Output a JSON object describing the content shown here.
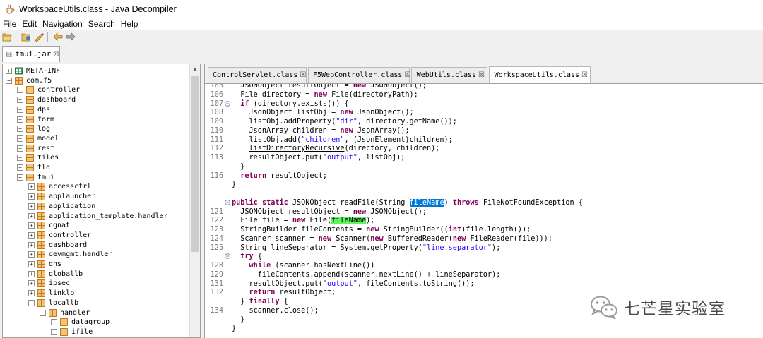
{
  "window": {
    "title": "WorkspaceUtils.class - Java Decompiler"
  },
  "menu": [
    "File",
    "Edit",
    "Navigation",
    "Search",
    "Help"
  ],
  "toolbar": {
    "buttons": [
      "open-file-icon",
      "open-type-icon",
      "open-type-hierarchy-icon",
      "back-icon",
      "forward-icon"
    ]
  },
  "file_tab": {
    "label": "tmui.jar",
    "close": "☒"
  },
  "tree": [
    {
      "label": "META-INF",
      "expander": "+",
      "icon": "folder"
    },
    {
      "label": "com.f5",
      "expander": "−",
      "icon": "package"
    },
    {
      "label": "controller",
      "expander": "+",
      "icon": "package"
    },
    {
      "label": "dashboard",
      "expander": "+",
      "icon": "package"
    },
    {
      "label": "dps",
      "expander": "+",
      "icon": "package"
    },
    {
      "label": "form",
      "expander": "+",
      "icon": "package"
    },
    {
      "label": "log",
      "expander": "+",
      "icon": "package"
    },
    {
      "label": "model",
      "expander": "+",
      "icon": "package"
    },
    {
      "label": "rest",
      "expander": "+",
      "icon": "package"
    },
    {
      "label": "tiles",
      "expander": "+",
      "icon": "package"
    },
    {
      "label": "tld",
      "expander": "+",
      "icon": "package"
    },
    {
      "label": "tmui",
      "expander": "−",
      "icon": "package"
    },
    {
      "label": "accessctrl",
      "expander": "+",
      "icon": "package"
    },
    {
      "label": "applauncher",
      "expander": "+",
      "icon": "package"
    },
    {
      "label": "application",
      "expander": "+",
      "icon": "package"
    },
    {
      "label": "application_template.handler",
      "expander": "+",
      "icon": "package"
    },
    {
      "label": "cgnat",
      "expander": "+",
      "icon": "package"
    },
    {
      "label": "controller",
      "expander": "+",
      "icon": "package"
    },
    {
      "label": "dashboard",
      "expander": "+",
      "icon": "package"
    },
    {
      "label": "devmgmt.handler",
      "expander": "+",
      "icon": "package"
    },
    {
      "label": "dns",
      "expander": "+",
      "icon": "package"
    },
    {
      "label": "globallb",
      "expander": "+",
      "icon": "package"
    },
    {
      "label": "ipsec",
      "expander": "+",
      "icon": "package"
    },
    {
      "label": "linklb",
      "expander": "+",
      "icon": "package"
    },
    {
      "label": "locallb",
      "expander": "−",
      "icon": "package"
    },
    {
      "label": "handler",
      "expander": "−",
      "icon": "package"
    },
    {
      "label": "datagroup",
      "expander": "+",
      "icon": "package"
    },
    {
      "label": "ifile",
      "expander": "+",
      "icon": "package"
    },
    {
      "label": "",
      "expander": "+",
      "icon": "package"
    }
  ],
  "editor_tabs": [
    {
      "label": "ControlServlet.class",
      "close": "☒",
      "active": false
    },
    {
      "label": "F5WebController.class",
      "close": "☒",
      "active": false
    },
    {
      "label": "WebUtils.class",
      "close": "☒",
      "active": false
    },
    {
      "label": "WorkspaceUtils.class",
      "close": "☒",
      "active": true
    }
  ],
  "code_lines": [
    {
      "ln": "105",
      "fold": false,
      "html": "  JSONObject resultObject = <span class=\"kw\">new</span> JSONObject();"
    },
    {
      "ln": "106",
      "fold": false,
      "html": "  File directory = <span class=\"kw\">new</span> File(directoryPath);"
    },
    {
      "ln": "107",
      "fold": true,
      "html": "  <span class=\"kw\">if</span> (directory.exists()) {"
    },
    {
      "ln": "108",
      "fold": false,
      "html": "    JsonObject listObj = <span class=\"kw\">new</span> JsonObject();"
    },
    {
      "ln": "109",
      "fold": false,
      "html": "    listObj.addProperty(<span class=\"str\">\"dir\"</span>, directory.getName());"
    },
    {
      "ln": "110",
      "fold": false,
      "html": "    JsonArray children = <span class=\"kw\">new</span> JsonArray();"
    },
    {
      "ln": "111",
      "fold": false,
      "html": "    listObj.add(<span class=\"str\">\"children\"</span>, (JsonElement)children);"
    },
    {
      "ln": "112",
      "fold": false,
      "html": "    <span class=\"ul\">listDirectoryRecursive</span>(directory, children);"
    },
    {
      "ln": "113",
      "fold": false,
      "html": "    resultObject.put(<span class=\"str\">\"output\"</span>, listObj);"
    },
    {
      "ln": "",
      "fold": false,
      "html": "  }"
    },
    {
      "ln": "116",
      "fold": false,
      "html": "  <span class=\"kw\">return</span> resultObject;"
    },
    {
      "ln": "",
      "fold": false,
      "html": "}"
    },
    {
      "ln": "",
      "fold": false,
      "html": ""
    },
    {
      "ln": "",
      "fold": true,
      "html": "<span class=\"kw\">public</span> <span class=\"kw\">static</span> JSONObject readFile(String <span class=\"hl-sel\">fileName</span>) <span class=\"kw\">throws</span> FileNotFoundException {"
    },
    {
      "ln": "121",
      "fold": false,
      "html": "  JSONObject resultObject = <span class=\"kw\">new</span> JSONObject();"
    },
    {
      "ln": "122",
      "fold": false,
      "html": "  File file = <span class=\"kw\">new</span> File(<span class=\"hl-occ\">fileName</span>);"
    },
    {
      "ln": "123",
      "fold": false,
      "html": "  StringBuilder fileContents = <span class=\"kw\">new</span> StringBuilder((<span class=\"kw\">int</span>)file.length());"
    },
    {
      "ln": "124",
      "fold": false,
      "html": "  Scanner scanner = <span class=\"kw\">new</span> Scanner(<span class=\"kw\">new</span> BufferedReader(<span class=\"kw\">new</span> FileReader(file)));"
    },
    {
      "ln": "125",
      "fold": false,
      "html": "  String lineSeparator = System.getProperty(<span class=\"str\">\"line.separator\"</span>);"
    },
    {
      "ln": "",
      "fold": true,
      "html": "  <span class=\"kw\">try</span> {"
    },
    {
      "ln": "128",
      "fold": false,
      "html": "    <span class=\"kw\">while</span> (scanner.hasNextLine())"
    },
    {
      "ln": "129",
      "fold": false,
      "html": "      fileContents.append(scanner.nextLine() + lineSeparator);"
    },
    {
      "ln": "131",
      "fold": false,
      "html": "    resultObject.put(<span class=\"str\">\"output\"</span>, fileContents.toString());"
    },
    {
      "ln": "132",
      "fold": false,
      "html": "    <span class=\"kw\">return</span> resultObject;"
    },
    {
      "ln": "",
      "fold": false,
      "html": "  } <span class=\"kw\">finally</span> {"
    },
    {
      "ln": "134",
      "fold": false,
      "html": "    scanner.close();"
    },
    {
      "ln": "",
      "fold": false,
      "html": "  }"
    },
    {
      "ln": "",
      "fold": false,
      "html": "}"
    }
  ],
  "watermark": {
    "text": "七芒星实验室"
  },
  "colors": {
    "keyword": "#7f0055",
    "string": "#2a00ff",
    "selection": "#0078d7",
    "occurrence": "#5ef55e",
    "package": "#c47a1a"
  }
}
